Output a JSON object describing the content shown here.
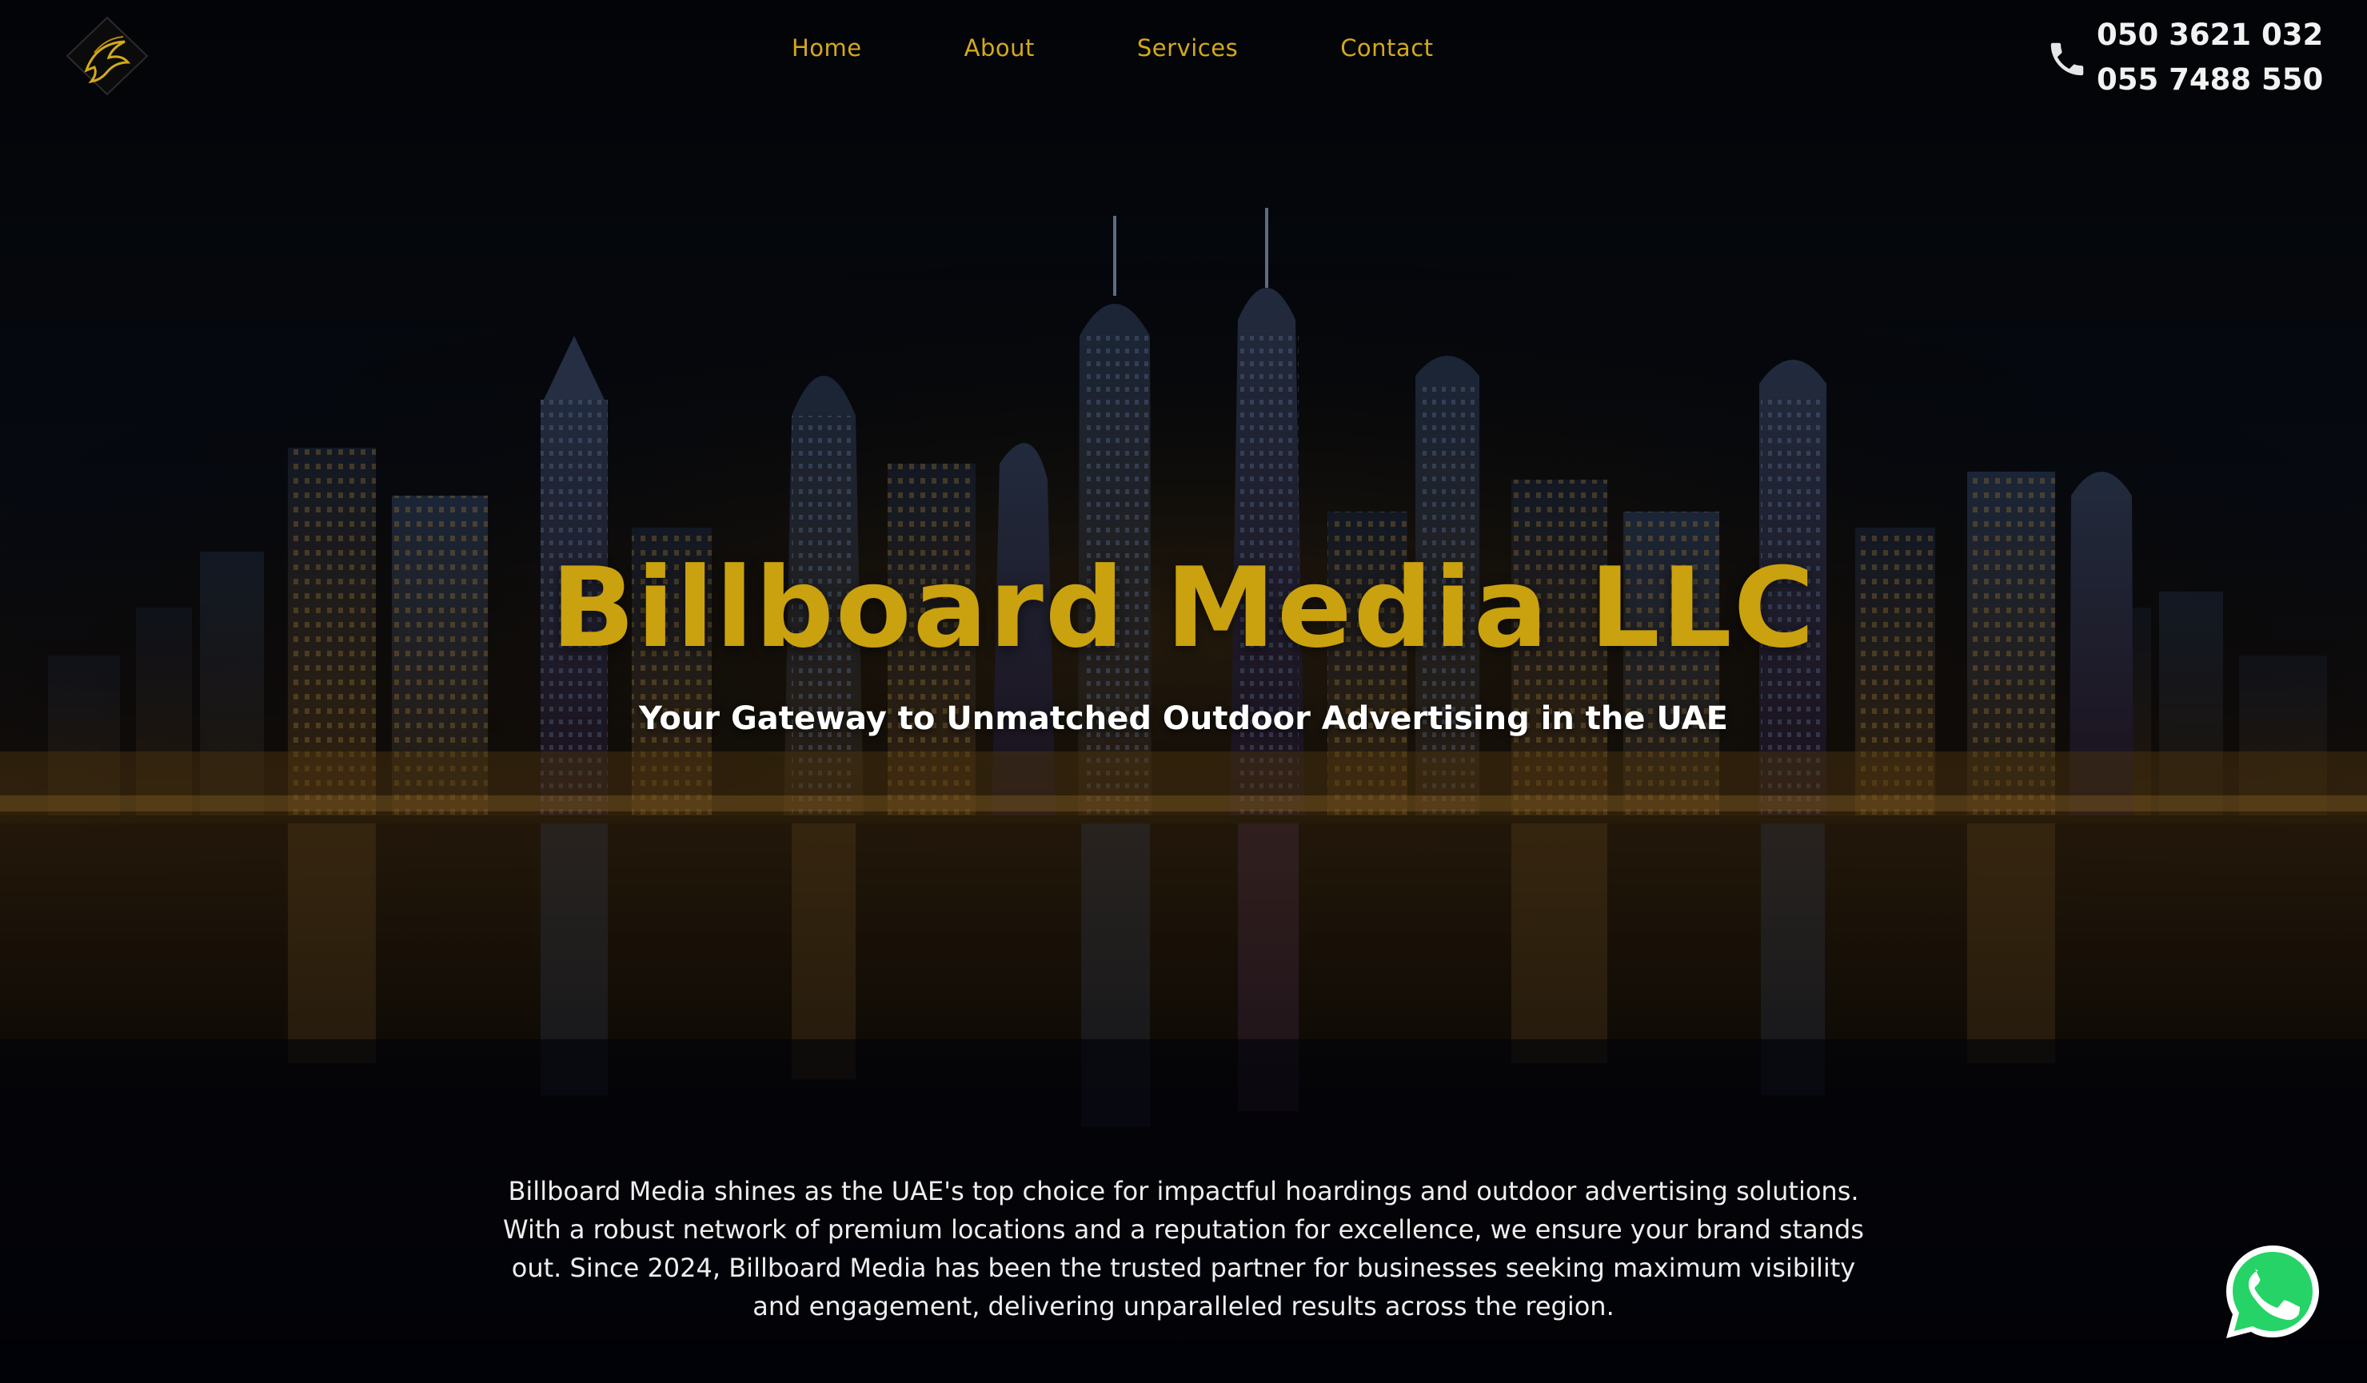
{
  "brand": {
    "logo_icon": "eagle-diamond-logo-icon",
    "accent_color": "#caa10f",
    "nav_color": "#d4a91c"
  },
  "nav": {
    "items": [
      {
        "label": "Home"
      },
      {
        "label": "About"
      },
      {
        "label": "Services"
      },
      {
        "label": "Contact"
      }
    ]
  },
  "contact": {
    "phone_icon": "phone-icon",
    "phones": [
      "050 3621 032",
      "055 7488 550"
    ]
  },
  "hero": {
    "title": "Billboard Media LLC",
    "subtitle": "Your Gateway to Unmatched Outdoor Advertising in the UAE",
    "background": "night city skyline reflected in water"
  },
  "about": {
    "text": "Billboard Media shines as the UAE's top choice for impactful hoardings and outdoor advertising solutions. With a robust network of premium locations and a reputation for excellence, we ensure your brand stands out. Since 2024, Billboard Media has been the trusted partner for businesses seeking maximum visibility and engagement, delivering unparalleled results across the region."
  },
  "floating": {
    "whatsapp_icon": "whatsapp-icon",
    "whatsapp_color": "#25d366"
  }
}
